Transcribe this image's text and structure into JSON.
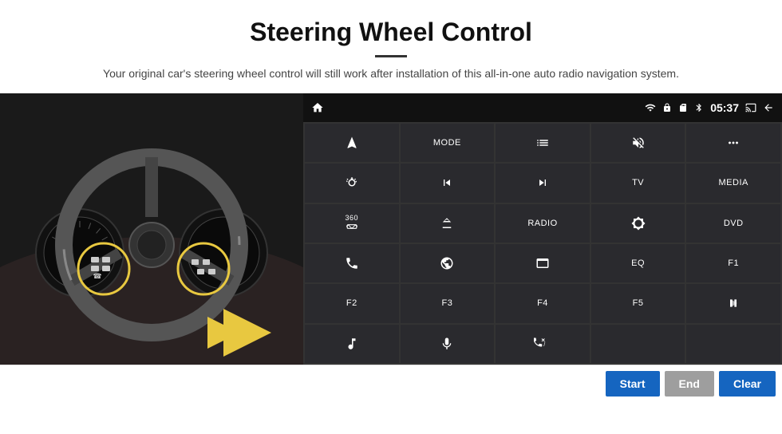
{
  "header": {
    "title": "Steering Wheel Control",
    "subtitle": "Your original car's steering wheel control will still work after installation of this all-in-one auto radio navigation system."
  },
  "status_bar": {
    "time": "05:37",
    "icons": [
      "wifi",
      "lock",
      "card",
      "bluetooth",
      "screen",
      "back"
    ]
  },
  "control_buttons": [
    {
      "id": "row1",
      "cells": [
        {
          "label": "",
          "icon": "navigate"
        },
        {
          "label": "MODE",
          "icon": ""
        },
        {
          "label": "",
          "icon": "list"
        },
        {
          "label": "",
          "icon": "mute"
        },
        {
          "label": "",
          "icon": "dots"
        }
      ]
    },
    {
      "id": "row2",
      "cells": [
        {
          "label": "",
          "icon": "settings-circle"
        },
        {
          "label": "",
          "icon": "prev"
        },
        {
          "label": "",
          "icon": "next"
        },
        {
          "label": "TV",
          "icon": ""
        },
        {
          "label": "MEDIA",
          "icon": ""
        }
      ]
    },
    {
      "id": "row3",
      "cells": [
        {
          "label": "",
          "icon": "360"
        },
        {
          "label": "",
          "icon": "eject"
        },
        {
          "label": "RADIO",
          "icon": ""
        },
        {
          "label": "",
          "icon": "brightness"
        },
        {
          "label": "DVD",
          "icon": ""
        }
      ]
    },
    {
      "id": "row4",
      "cells": [
        {
          "label": "",
          "icon": "phone"
        },
        {
          "label": "",
          "icon": "orbit"
        },
        {
          "label": "",
          "icon": "window"
        },
        {
          "label": "EQ",
          "icon": ""
        },
        {
          "label": "F1",
          "icon": ""
        }
      ]
    },
    {
      "id": "row5",
      "cells": [
        {
          "label": "F2",
          "icon": ""
        },
        {
          "label": "F3",
          "icon": ""
        },
        {
          "label": "F4",
          "icon": ""
        },
        {
          "label": "F5",
          "icon": ""
        },
        {
          "label": "",
          "icon": "play-pause"
        }
      ]
    },
    {
      "id": "row6",
      "cells": [
        {
          "label": "",
          "icon": "music"
        },
        {
          "label": "",
          "icon": "mic"
        },
        {
          "label": "",
          "icon": "vol-phone"
        },
        {
          "label": "",
          "icon": ""
        },
        {
          "label": "",
          "icon": ""
        }
      ]
    }
  ],
  "bottom_buttons": {
    "start": "Start",
    "end": "End",
    "clear": "Clear"
  }
}
